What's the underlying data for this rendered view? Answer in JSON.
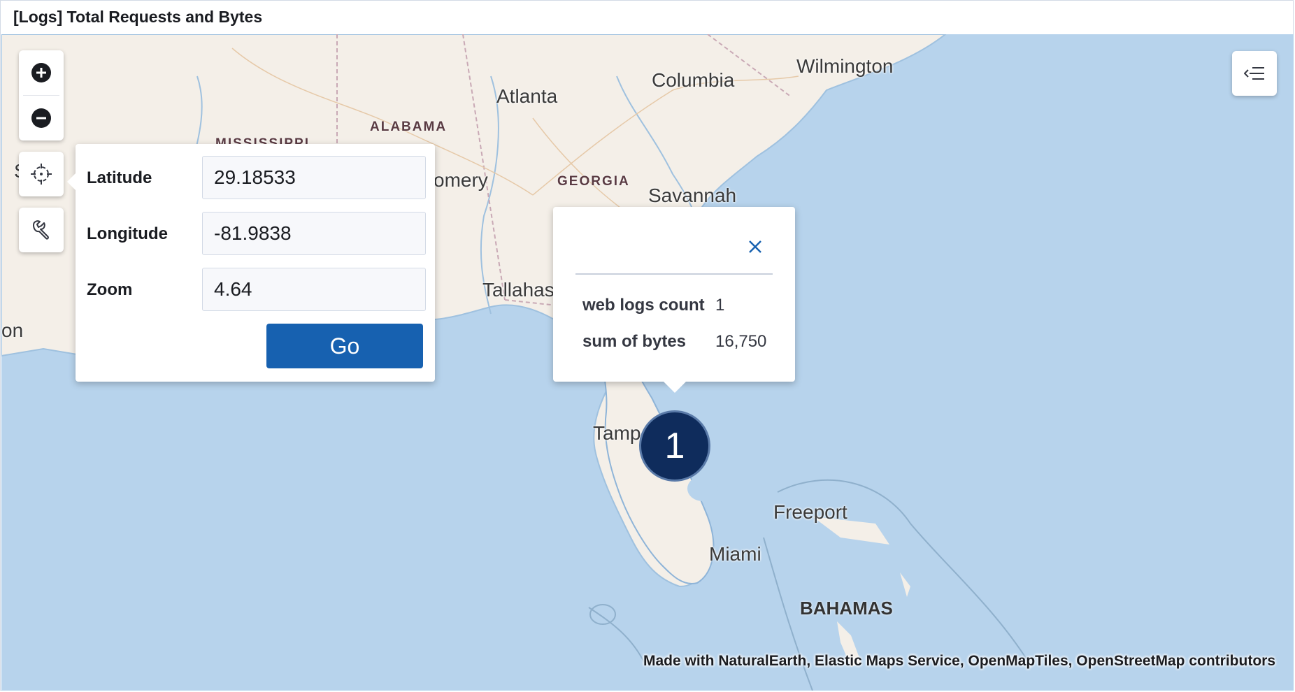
{
  "panel": {
    "title": "[Logs] Total Requests and Bytes"
  },
  "map": {
    "cities": {
      "wilmington": "Wilmington",
      "columbia": "Columbia",
      "atlanta": "Atlanta",
      "savannah": "Savannah",
      "montgomery_partial": "omery",
      "tallahassee_partial": "Tallahas",
      "tampa_partial": "Tampa",
      "freeport": "Freeport",
      "miami": "Miami",
      "left_edge_partial": "on",
      "left_edge_s": "S"
    },
    "states": {
      "alabama": "ALABAMA",
      "georgia": "GEORGIA",
      "mississippi_partial": "MISSISSIPPI"
    },
    "countries": {
      "bahamas": "BAHAMAS"
    },
    "attribution": "Made with NaturalEarth, Elastic Maps Service, OpenMapTiles, OpenStreetMap contributors"
  },
  "controls": {
    "zoom_in_icon": "plus-circle-icon",
    "zoom_out_icon": "minus-circle-icon",
    "set_view_icon": "crosshair-icon",
    "tools_icon": "wrench-icon",
    "layers_icon": "menu-left-icon"
  },
  "set_view": {
    "latitude_label": "Latitude",
    "latitude_value": "29.18533",
    "longitude_label": "Longitude",
    "longitude_value": "-81.9838",
    "zoom_label": "Zoom",
    "zoom_value": "4.64",
    "go_label": "Go"
  },
  "tooltip": {
    "rows": [
      {
        "key": "web logs count",
        "value": "1"
      },
      {
        "key": "sum of bytes",
        "value": "16,750"
      }
    ]
  },
  "marker": {
    "count": "1"
  },
  "colors": {
    "water": "#b7d3ec",
    "land": "#f4efe8",
    "go_button": "#1761b0",
    "marker": "#0f2c5c"
  }
}
